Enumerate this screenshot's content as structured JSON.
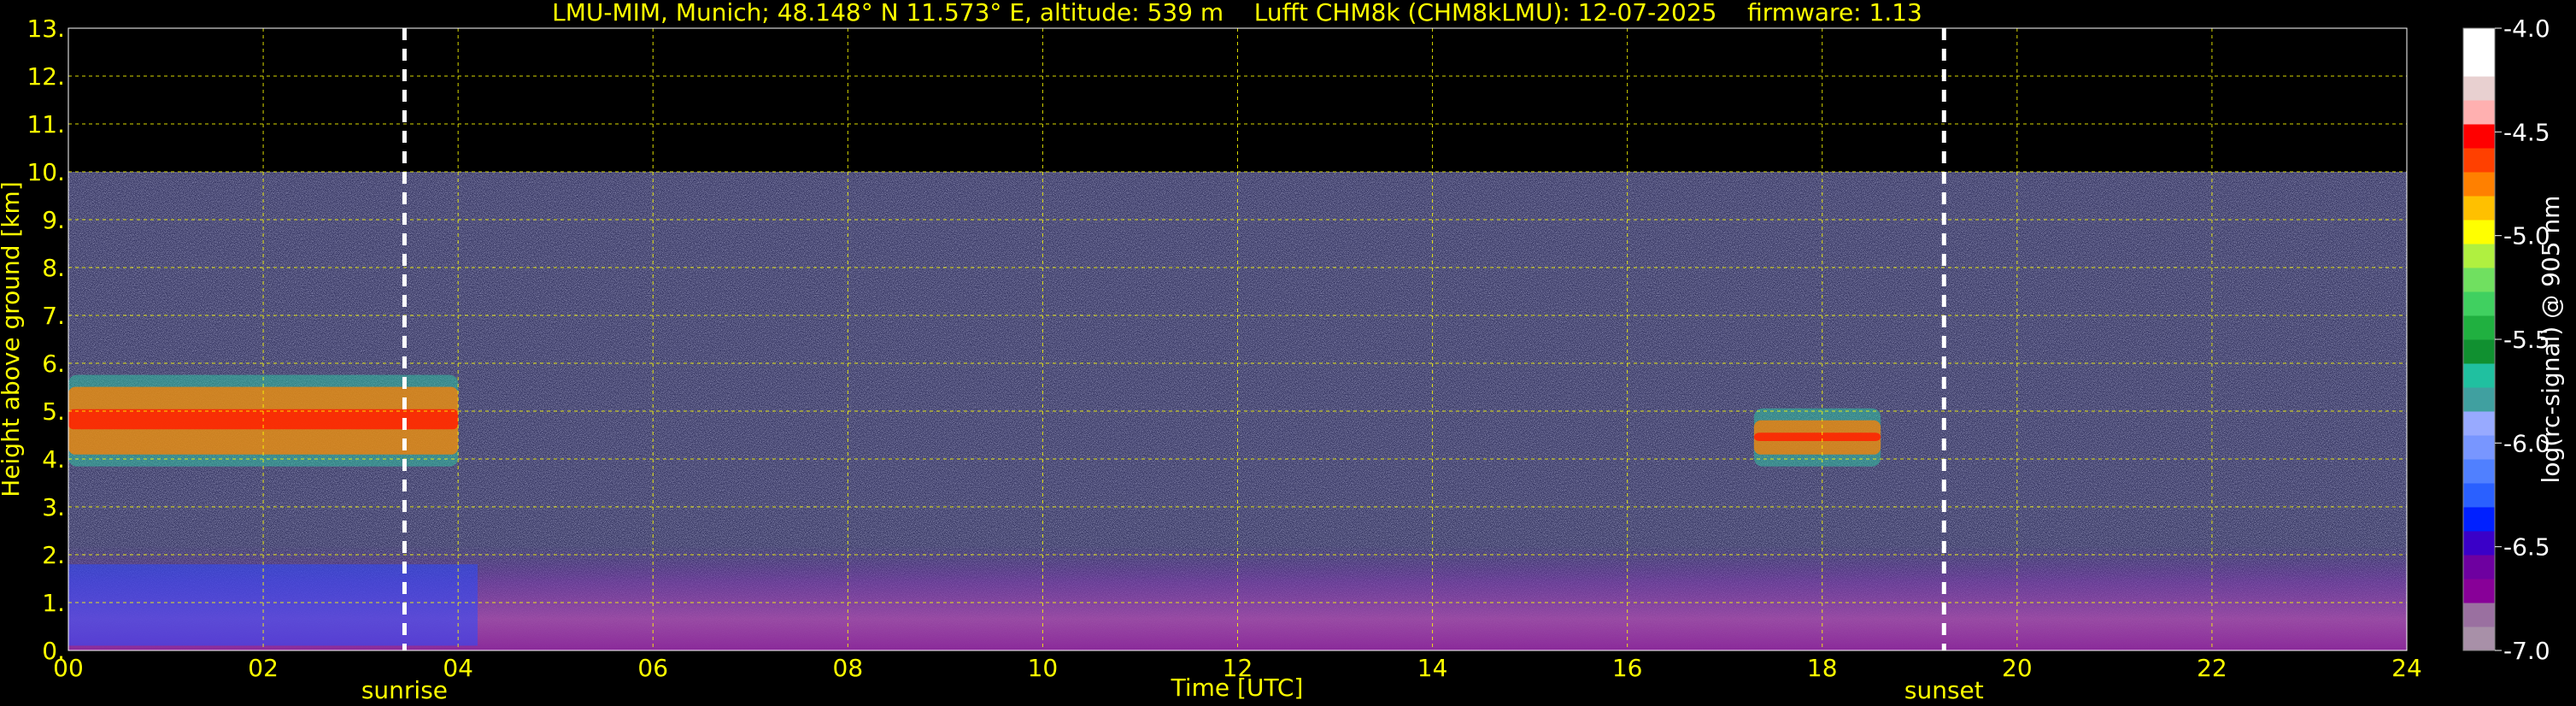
{
  "chart_data": {
    "type": "heatmap",
    "title": "LMU-MIM, Munich; 48.148° N 11.573° E, altitude: 539 m    Lufft CHM8k (CHM8kLMU): 12-07-2025    firmware: 1.13",
    "xlabel": "Time [UTC]",
    "ylabel": "Height above ground [km]",
    "xlim": [
      0,
      24
    ],
    "ylim": [
      0,
      13
    ],
    "x_ticks": [
      "00",
      "02",
      "04",
      "06",
      "08",
      "10",
      "12",
      "14",
      "16",
      "18",
      "20",
      "22",
      "24"
    ],
    "y_ticks": [
      "0.",
      "1.",
      "2.",
      "3.",
      "4.",
      "5.",
      "6.",
      "7.",
      "8.",
      "9.",
      "10.",
      "11.",
      "12.",
      "13."
    ],
    "grid": true,
    "max_range_km": 10,
    "markers": [
      {
        "label": "sunrise",
        "time_utc": 3.45
      },
      {
        "label": "sunset",
        "time_utc": 19.25
      }
    ],
    "colorbar": {
      "label": "log(rc-signal) @ 905 nm",
      "range": [
        -7.0,
        -4.0
      ],
      "ticks": [
        "-4.0",
        "-4.5",
        "-5.0",
        "-5.5",
        "-6.0",
        "-6.5",
        "-7.0"
      ],
      "colors": [
        "#a890a8",
        "#9a70a0",
        "#880098",
        "#6e00a0",
        "#3a00c8",
        "#0020ff",
        "#2a60ff",
        "#5080ff",
        "#7896ff",
        "#98aaff",
        "#40a0a0",
        "#20c0a0",
        "#109030",
        "#20b040",
        "#40d060",
        "#70e060",
        "#b0f040",
        "#ffff00",
        "#ffc000",
        "#ff8000",
        "#ff4000",
        "#ff0000",
        "#ffb0b0",
        "#e8d0d0",
        "#ffffff",
        "#ffffff"
      ]
    },
    "features": [
      {
        "name": "cloud layer",
        "t_start": 0.0,
        "t_end": 4.0,
        "height_km": [
          4.2,
          5.4
        ]
      },
      {
        "name": "boundary layer",
        "t_start": 0.0,
        "t_end": 24.0,
        "height_km": [
          0.0,
          1.0
        ]
      },
      {
        "name": "cloud layer",
        "t_start": 17.3,
        "t_end": 18.6,
        "height_km": [
          4.2,
          4.7
        ]
      }
    ]
  }
}
